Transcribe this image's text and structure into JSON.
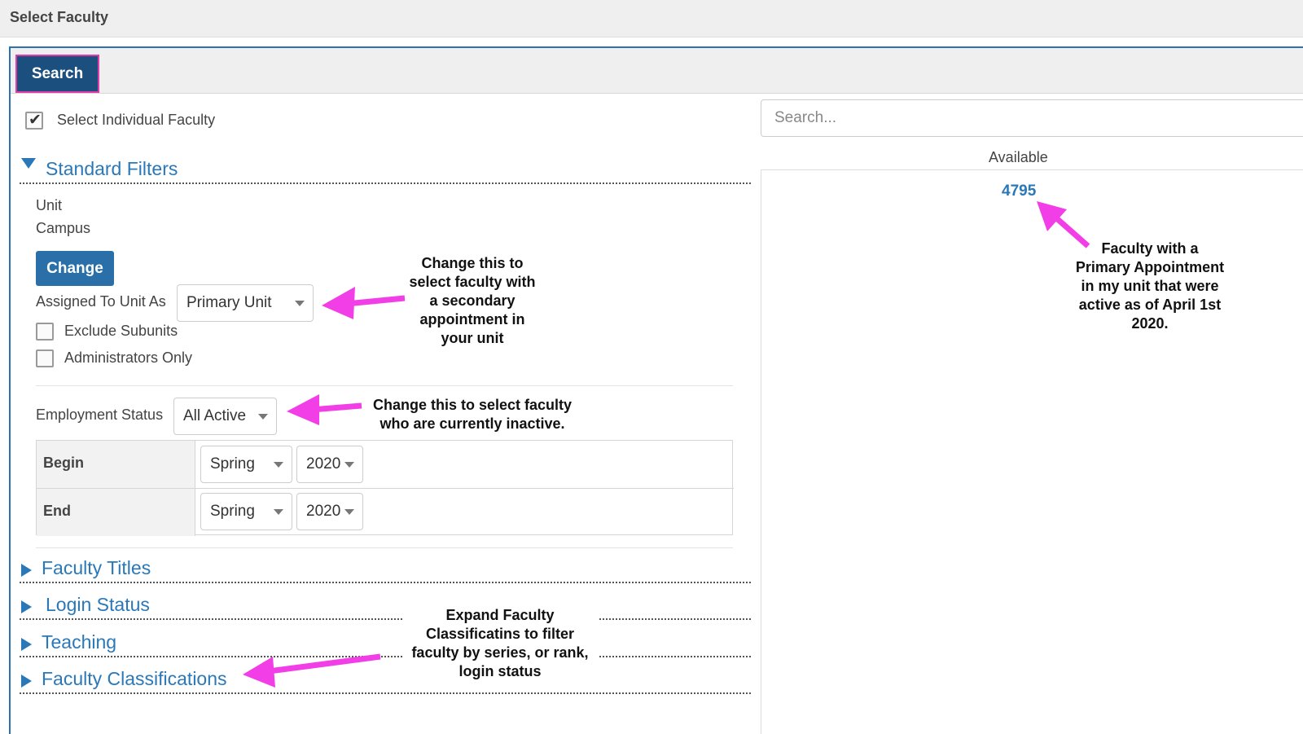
{
  "window": {
    "title": "Select Faculty"
  },
  "tabs": {
    "search_label": "Search"
  },
  "individual": {
    "label": "Select Individual Faculty",
    "checked": true
  },
  "standard_filters": {
    "heading": "Standard Filters",
    "unit_label": "Unit",
    "campus_label": "Campus",
    "change_label": "Change",
    "assigned_label": "Assigned To Unit As",
    "assigned_value": "Primary Unit",
    "exclude_subunits": "Exclude Subunits",
    "admins_only": "Administrators Only",
    "employment_label": "Employment Status",
    "employment_value": "All Active",
    "begin_label": "Begin",
    "end_label": "End",
    "begin_term": "Spring",
    "begin_year": "2020",
    "end_term": "Spring",
    "end_year": "2020"
  },
  "sections": {
    "faculty_titles": "Faculty Titles",
    "login_status": "Login Status",
    "teaching": "Teaching",
    "faculty_classifications": "Faculty Classifications"
  },
  "right": {
    "search_placeholder": "Search...",
    "available_label": "Available",
    "available_count": "4795"
  },
  "annotations": {
    "assigned_note": [
      "Change this to",
      "select faculty with",
      "a secondary",
      "appointment in",
      "your unit"
    ],
    "employment_note": [
      "Change this to select faculty",
      "who are currently inactive."
    ],
    "classifications_note": [
      "Expand Faculty",
      "Classificatins to filter",
      "faculty by series, or rank,",
      "login status"
    ],
    "available_note": [
      "Faculty with a",
      "Primary Appointment",
      "in my unit that were",
      "active as of April 1st",
      "2020."
    ],
    "arrow_color": "#f23ee6"
  }
}
